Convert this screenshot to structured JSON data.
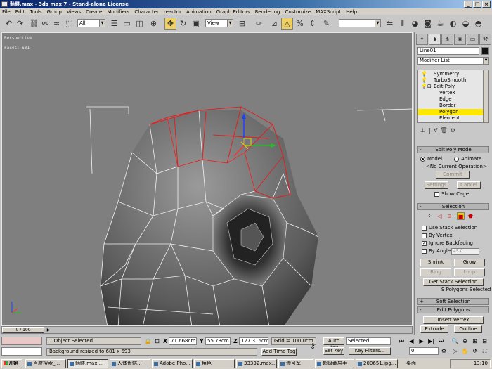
{
  "window": {
    "title": "骷髅.max - 3ds max 7 - Stand-alone License",
    "buttons": [
      "_",
      "□",
      "×"
    ]
  },
  "menu": [
    "File",
    "Edit",
    "Tools",
    "Group",
    "Views",
    "Create",
    "Modifiers",
    "Character",
    "reactor",
    "Animation",
    "Graph Editors",
    "Rendering",
    "Customize",
    "MAXScript",
    "Help"
  ],
  "toolbar": {
    "selection_filter": "All",
    "reference_coord": "View",
    "named_selection": ""
  },
  "viewport": {
    "label": "Perspective",
    "faces": "Faces: 501"
  },
  "timeslider": {
    "position": "0 / 100"
  },
  "command_panel": {
    "object_name": "Line01",
    "modifier_list": "Modifier List",
    "stack": [
      {
        "label": "Symmetry",
        "level": 0
      },
      {
        "label": "TurboSmooth",
        "level": 0
      },
      {
        "label": "Edit Poly",
        "level": 0
      },
      {
        "label": "Vertex",
        "level": 1
      },
      {
        "label": "Edge",
        "level": 1
      },
      {
        "label": "Border",
        "level": 1
      },
      {
        "label": "Polygon",
        "level": 1,
        "selected": true
      },
      {
        "label": "Element",
        "level": 1
      }
    ],
    "edit_poly_mode": {
      "title": "Edit Poly Mode",
      "model": "Model",
      "animate": "Animate",
      "operation": "<No Current Operation>",
      "commit": "Commit",
      "settings": "Settings",
      "cancel": "Cancel",
      "show_cage": "Show Cage"
    },
    "selection": {
      "title": "Selection",
      "use_stack": "Use Stack Selection",
      "by_vertex": "By Vertex",
      "ignore_backfacing": "Ignore Backfacing",
      "by_angle": "By Angle:",
      "angle_value": "45.0",
      "shrink": "Shrink",
      "grow": "Grow",
      "ring": "Ring",
      "loop": "Loop",
      "get_stack": "Get Stack Selection",
      "status": "9 Polygons Selected"
    },
    "soft_selection": "Soft Selection",
    "edit_polygons": {
      "title": "Edit Polygons",
      "insert_vertex": "Insert Vertex",
      "extrude": "Extrude",
      "outline": "Outline"
    }
  },
  "status": {
    "selected_count": "1 Object Selected",
    "prompt": "Background resized to 681 x 693",
    "x_label": "X",
    "x": "71.668cm",
    "y_label": "Y",
    "y": "55.73cm",
    "z_label": "Z",
    "z": "127.316cm",
    "grid": "Grid = 100.0cm",
    "add_time_tag": "Add Time Tag",
    "auto_key": "Auto Key",
    "auto_key_mode": "Selected",
    "set_key": "Set Key",
    "key_filters": "Key Filters...",
    "frame": "0"
  },
  "taskbar": {
    "start": "开始",
    "tasks": [
      "百度搜索_...",
      "骷髅.max ...",
      "人体骨骼...",
      "Adobe Pho...",
      "角色",
      "33332.max...",
      "漂可军",
      "超级截屏手",
      "200651.jpg..."
    ],
    "active_index": 1,
    "tray_label": "桌面",
    "time": "13:10"
  }
}
